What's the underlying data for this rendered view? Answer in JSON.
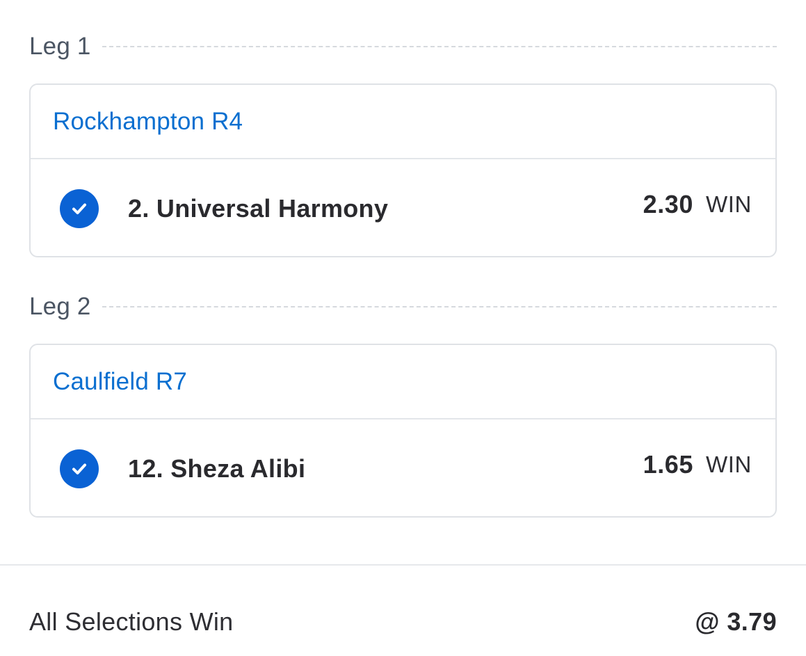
{
  "legs": [
    {
      "title": "Leg 1",
      "race": "Rockhampton R4",
      "selection": "2. Universal Harmony",
      "selected": true,
      "price": "2.30",
      "bet_type": "WIN"
    },
    {
      "title": "Leg 2",
      "race": "Caulfield R7",
      "selection": "12. Sheza Alibi",
      "selected": true,
      "price": "1.65",
      "bet_type": "WIN"
    }
  ],
  "summary": {
    "label": "All Selections Win",
    "odds": "@ 3.79"
  },
  "colors": {
    "accent": "#0a62d4",
    "link": "#0a6fd0",
    "text": "#2a2a2e",
    "muted": "#4b5563",
    "border": "#dfe2e6"
  },
  "icons": {
    "selected": "check-circle-icon"
  }
}
